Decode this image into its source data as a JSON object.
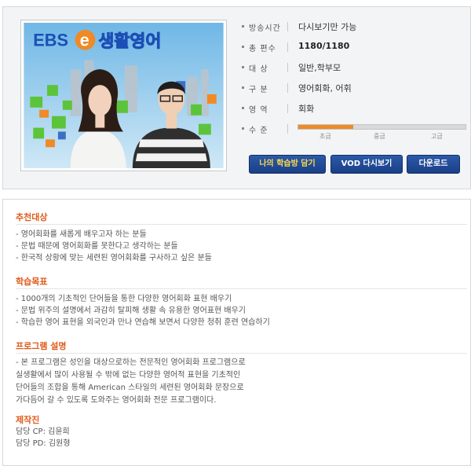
{
  "thumbnail": {
    "brand": "EBS",
    "brand_e": "e",
    "title": "생활영어"
  },
  "info": [
    {
      "label": "방송시간",
      "value": "다시보기만 가능"
    },
    {
      "label": "총 편수",
      "value": "1180/1180"
    },
    {
      "label": "대  상",
      "value": "일반,학부모"
    },
    {
      "label": "구  분",
      "value": "영어회화, 어휘"
    },
    {
      "label": "영  역",
      "value": "회화"
    },
    {
      "label": "수  준",
      "value": ""
    }
  ],
  "level": {
    "fraction": 0.33,
    "labels": [
      "초급",
      "중급",
      "고급"
    ],
    "fill_color": "#f08a24"
  },
  "buttons": {
    "my_room": "나의 학습방 담기",
    "vod": "VOD 다시보기",
    "download": "다운로드"
  },
  "sections": {
    "target": {
      "title": "추천대상",
      "items": [
        "- 영어회화를 새롭게 배우고자 하는 분들",
        "- 문법 때문에 영어회화를 못한다고 생각하는 분들",
        "- 한국적 상황에 맞는 세련된 영어회화를 구사하고 싶은 분들"
      ]
    },
    "goal": {
      "title": "학습목표",
      "items": [
        "- 1000개의 기초적인 단어들을 통한 다양한 영어회화 표현 배우기",
        "- 문법 위주의 설명에서 과감히 탈피해 생활 속 유용한 영어표현 배우기",
        "- 학습한 영어 표현을 외국인과 만나 연습해 보면서 다양한 청취 훈련 연습하기"
      ]
    },
    "program": {
      "title": "프로그램 설명",
      "lines": [
        "- 본 프로그램은 성인을 대상으로하는 전문적인 영어회화 프로그램으로",
        "실생활에서 많이 사용될 수 밖에 없는 다양한 영어적 표현을 기초적인",
        "단어들의 조합을 통해 American 스타일의 세련된 영어회화 문장으로",
        "가다듬어 갈 수 있도록 도와주는 영어회화 전문 프로그램이다."
      ]
    },
    "staff": {
      "title": "제작진",
      "cp": "담당 CP: 김윤희",
      "pd": "담당 PD: 김원형"
    }
  },
  "colors": {
    "accent_orange": "#e05a1a",
    "button_blue": "#1a3f86"
  }
}
